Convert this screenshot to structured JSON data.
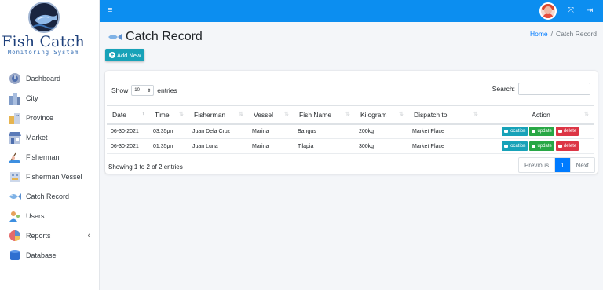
{
  "brand": {
    "title": "Fish Catch",
    "subtitle": "Monitoring System"
  },
  "sidebar": {
    "items": [
      {
        "label": "Dashboard",
        "icon": "dashboard-icon"
      },
      {
        "label": "City",
        "icon": "city-icon"
      },
      {
        "label": "Province",
        "icon": "province-icon"
      },
      {
        "label": "Market",
        "icon": "market-icon"
      },
      {
        "label": "Fisherman",
        "icon": "fisherman-icon"
      },
      {
        "label": "Fisherman Vessel",
        "icon": "vessel-icon"
      },
      {
        "label": "Catch Record",
        "icon": "fish-icon"
      },
      {
        "label": "Users",
        "icon": "users-icon"
      },
      {
        "label": "Reports",
        "icon": "reports-icon",
        "chevron": "‹"
      },
      {
        "label": "Database",
        "icon": "database-icon"
      }
    ]
  },
  "topbar": {
    "menu_glyph": "≡",
    "fullscreen_glyph": "⤧",
    "logout_glyph": "⇥"
  },
  "page": {
    "title": "Catch Record"
  },
  "breadcrumb": {
    "home": "Home",
    "separator": "/",
    "current": "Catch Record"
  },
  "add_button": {
    "label": "Add New"
  },
  "table_controls": {
    "show_label": "Show",
    "show_value": "10",
    "entries_label": "entries",
    "search_label": "Search:",
    "search_value": ""
  },
  "table": {
    "columns": [
      "Date",
      "Time",
      "Fisherman",
      "Vessel",
      "Fish Name",
      "Kilogram",
      "Dispatch to",
      "Action"
    ],
    "rows": [
      {
        "date": "06-30-2021",
        "time": "03:35pm",
        "fisherman": "Juan Dela Cruz",
        "vessel": "Marina",
        "fish": "Bangus",
        "kg": "200kg",
        "dispatch": "Market Place"
      },
      {
        "date": "06-30-2021",
        "time": "01:35pm",
        "fisherman": "Juan Luna",
        "vessel": "Marina",
        "fish": "Tilapia",
        "kg": "300kg",
        "dispatch": "Market Place"
      }
    ],
    "actions": {
      "location": "location",
      "update": "update",
      "delete": "delete"
    }
  },
  "footer": {
    "info": "Showing 1 to 2 of 2 entries",
    "previous": "Previous",
    "page": "1",
    "next": "Next"
  },
  "colors": {
    "topbar": "#0c8ef0",
    "info": "#17a2b8",
    "success": "#28a745",
    "danger": "#dc3545",
    "primary": "#007bff"
  }
}
